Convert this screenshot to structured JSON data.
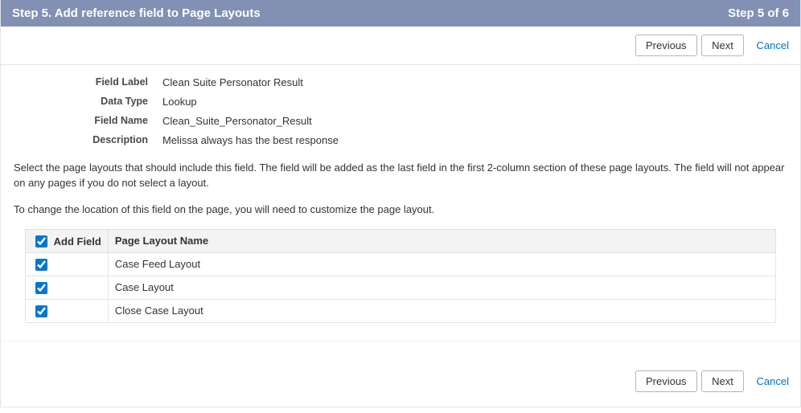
{
  "header": {
    "title": "Step 5. Add reference field to Page Layouts",
    "step_indicator": "Step 5 of 6"
  },
  "nav": {
    "previous": "Previous",
    "next": "Next",
    "cancel": "Cancel"
  },
  "fields": {
    "label_label": "Field Label",
    "label_value": "Clean Suite Personator Result",
    "type_label": "Data Type",
    "type_value": "Lookup",
    "name_label": "Field Name",
    "name_value": "Clean_Suite_Personator_Result",
    "desc_label": "Description",
    "desc_value": "Melissa always has the best response"
  },
  "instructions": {
    "p1": "Select the page layouts that should include this field. The field will be added as the last field in the first 2-column section of these page layouts. The field will not appear on any pages if you do not select a layout.",
    "p2": "To change the location of this field on the page, you will need to customize the page layout."
  },
  "layouts": {
    "header_add": "Add Field",
    "header_name": "Page Layout Name",
    "rows": [
      {
        "name": "Case Feed Layout"
      },
      {
        "name": "Case Layout"
      },
      {
        "name": "Close Case Layout"
      }
    ]
  }
}
